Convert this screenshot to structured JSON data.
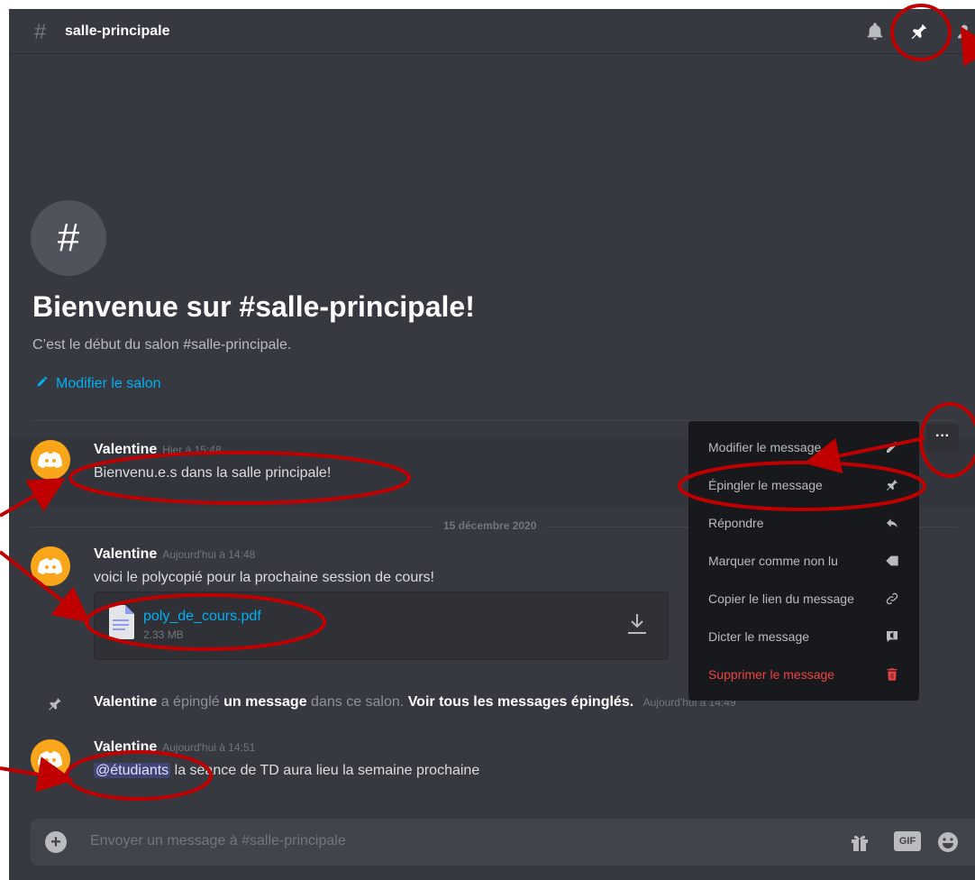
{
  "header": {
    "hash": "#",
    "channel_name": "salle-principale"
  },
  "welcome": {
    "hash": "#",
    "title": "Bienvenue sur #salle-principale!",
    "subtitle": "C’est le début du salon #salle-principale.",
    "edit_link": "Modifier le salon"
  },
  "date_divider": "15 décembre 2020",
  "messages": [
    {
      "author": "Valentine",
      "timestamp": "Hier à 15:48",
      "text": "Bienvenu.e.s dans la salle principale!"
    },
    {
      "author": "Valentine",
      "timestamp": "Aujourd'hui à 14:48",
      "text": "voici le polycopié pour la prochaine session de cours!",
      "attachment": {
        "filename": "poly_de_cours.pdf",
        "size": "2.33 MB"
      }
    },
    {
      "author": "Valentine",
      "timestamp": "Aujourd'hui à 14:51",
      "mention": "@étudiants",
      "text": "la séance de TD aura lieu la semaine prochaine"
    }
  ],
  "system_message": {
    "author": "Valentine",
    "part1": "a épinglé",
    "link1": "un message",
    "part2": "dans ce salon.",
    "link2": "Voir tous les messages épinglés.",
    "timestamp": "Aujourd'hui à 14:49"
  },
  "composer": {
    "placeholder": "Envoyer un message à #salle-principale",
    "gif_label": "GIF"
  },
  "more_button": "···",
  "context_menu": [
    {
      "label": "Modifier le message",
      "icon": "pencil-icon"
    },
    {
      "label": "Épingler le message",
      "icon": "pin-icon"
    },
    {
      "label": "Répondre",
      "icon": "reply-icon"
    },
    {
      "label": "Marquer comme non lu",
      "icon": "mark-unread-icon"
    },
    {
      "label": "Copier le lien du message",
      "icon": "link-icon"
    },
    {
      "label": "Dicter le message",
      "icon": "speak-icon"
    },
    {
      "label": "Supprimer le message",
      "icon": "trash-icon",
      "danger": true
    }
  ],
  "colors": {
    "background": "#36393f",
    "menu": "#18191c",
    "link": "#00b0f4",
    "danger": "#ed4245",
    "annotation": "#c00000",
    "avatar": "#faa61a"
  }
}
